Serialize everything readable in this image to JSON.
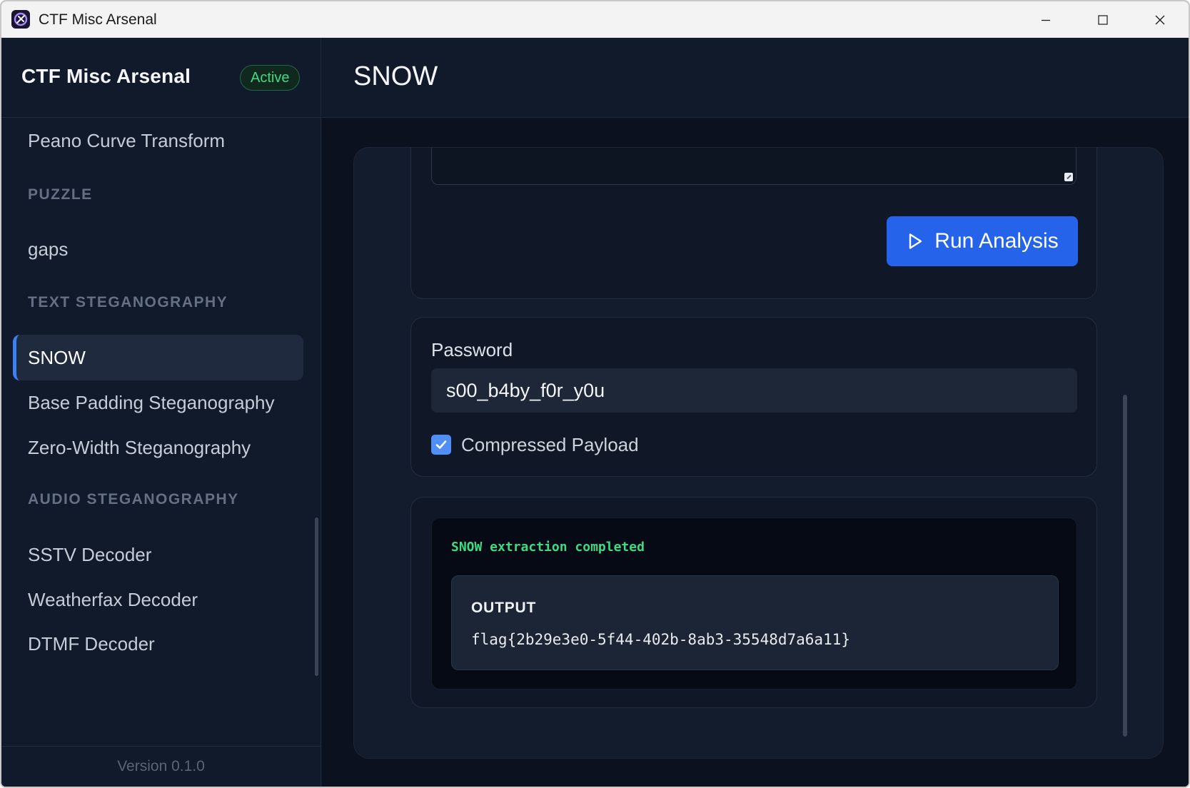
{
  "window": {
    "title": "CTF Misc Arsenal",
    "icon": "app-logo-icon"
  },
  "sidebar": {
    "brand": "CTF Misc Arsenal",
    "status_badge": "Active",
    "items": [
      {
        "type": "item",
        "label": "Peano Curve Transform"
      },
      {
        "type": "section",
        "label": "PUZZLE"
      },
      {
        "type": "item",
        "label": "gaps"
      },
      {
        "type": "section",
        "label": "TEXT STEGANOGRAPHY"
      },
      {
        "type": "item",
        "label": "SNOW",
        "active": true
      },
      {
        "type": "item",
        "label": "Base Padding Steganography"
      },
      {
        "type": "item",
        "label": "Zero-Width Steganography"
      },
      {
        "type": "section",
        "label": "AUDIO STEGANOGRAPHY"
      },
      {
        "type": "item",
        "label": "SSTV Decoder"
      },
      {
        "type": "item",
        "label": "Weatherfax Decoder"
      },
      {
        "type": "item",
        "label": "DTMF Decoder"
      }
    ],
    "version": "Version 0.1.0"
  },
  "main": {
    "title": "SNOW",
    "run_button": {
      "label": "Run Analysis",
      "icon": "play-icon"
    },
    "options": {
      "password_label": "Password",
      "password_value": "s00_b4by_f0r_y0u",
      "compressed_label": "Compressed Payload",
      "compressed_checked": true
    },
    "result": {
      "status": "SNOW extraction completed",
      "output_label": "OUTPUT",
      "output_value": "flag{2b29e3e0-5f44-402b-8ab3-35548d7a6a11}"
    }
  },
  "colors": {
    "accent": "#2563eb",
    "success": "#3ddc84",
    "background": "#0b111e",
    "sidebar": "#111a2b"
  }
}
